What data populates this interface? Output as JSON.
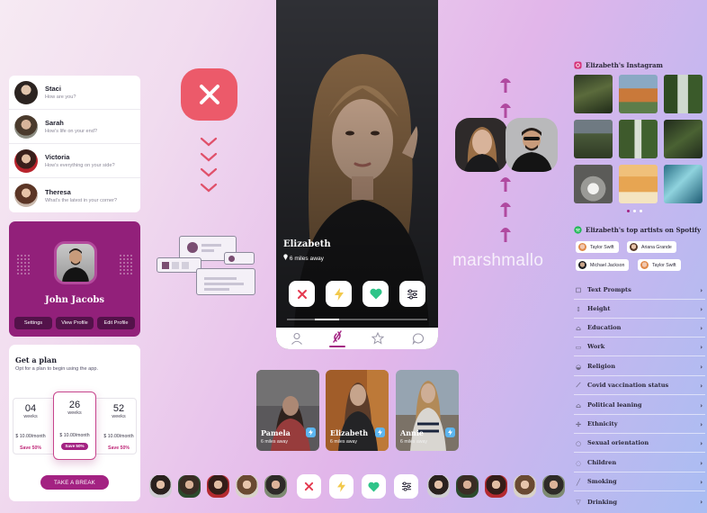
{
  "chats": [
    {
      "name": "Staci",
      "message": "How are you?"
    },
    {
      "name": "Sarah",
      "message": "How's life on your end?"
    },
    {
      "name": "Victoria",
      "message": "How's everything on your side?"
    },
    {
      "name": "Theresa",
      "message": "What's the latest in your corner?"
    }
  ],
  "profile": {
    "name": "John Jacobs",
    "buttons": [
      "Settings",
      "View Profile",
      "Edit Profile"
    ]
  },
  "plan": {
    "title": "Get a plan",
    "subtitle": "Opt for a plan to begin using the app.",
    "options": [
      {
        "number": "04",
        "unit": "weeks",
        "price": "$ 10.00/month",
        "save": "Save 50%"
      },
      {
        "number": "26",
        "unit": "weeks",
        "price": "$ 10.00/month",
        "save": "Save 50%"
      },
      {
        "number": "52",
        "unit": "weeks",
        "price": "$ 10.00/month",
        "save": "Save 50%"
      }
    ],
    "selected_index": 1,
    "cta": "TAKE A BREAK"
  },
  "phone": {
    "name": "Elizabeth",
    "distance": "6 miles away",
    "actions": [
      "close-icon",
      "bolt-icon",
      "heart-icon",
      "filter-icon"
    ],
    "tabs": [
      "person-icon",
      "flame-icon",
      "star-icon",
      "chat-icon"
    ],
    "active_tab": 1,
    "photo_index": 1,
    "photo_count": 5
  },
  "brand": "marshmallo",
  "mini_cards": [
    {
      "name": "Pamela",
      "distance": "6 miles away"
    },
    {
      "name": "Elizabeth",
      "distance": "6 miles away"
    },
    {
      "name": "Annie",
      "distance": "6 miles away"
    }
  ],
  "instagram": {
    "title": "Elizabeth's Instagram",
    "photo_count": 9,
    "active_page": 1,
    "page_count": 3
  },
  "spotify": {
    "title": "Elizabeth's top artists on Spotify",
    "artists": [
      "Taylor Swift",
      "Ariana Grande",
      "Michael Jackson",
      "Taylor Swift"
    ]
  },
  "preferences": [
    {
      "label": "Text Prompts",
      "icon": "speech-icon"
    },
    {
      "label": "Height",
      "icon": "ruler-icon"
    },
    {
      "label": "Education",
      "icon": "graduation-cap-icon"
    },
    {
      "label": "Work",
      "icon": "briefcase-icon"
    },
    {
      "label": "Religion",
      "icon": "hands-icon"
    },
    {
      "label": "Covid vaccination status",
      "icon": "syringe-icon"
    },
    {
      "label": "Political leaning",
      "icon": "institution-icon"
    },
    {
      "label": "Ethnicity",
      "icon": "globe-icon"
    },
    {
      "label": "Sexual orientation",
      "icon": "speech-bubbles-icon"
    },
    {
      "label": "Children",
      "icon": "child-icon"
    },
    {
      "label": "Smoking",
      "icon": "cigarette-icon"
    },
    {
      "label": "Drinking",
      "icon": "glass-icon"
    }
  ],
  "colors": {
    "accent": "#92207a",
    "cta": "#a32282",
    "dislike": "#ec5a6a",
    "bolt": "#f2c94c",
    "like": "#2fc489",
    "spotify": "#1db954"
  }
}
